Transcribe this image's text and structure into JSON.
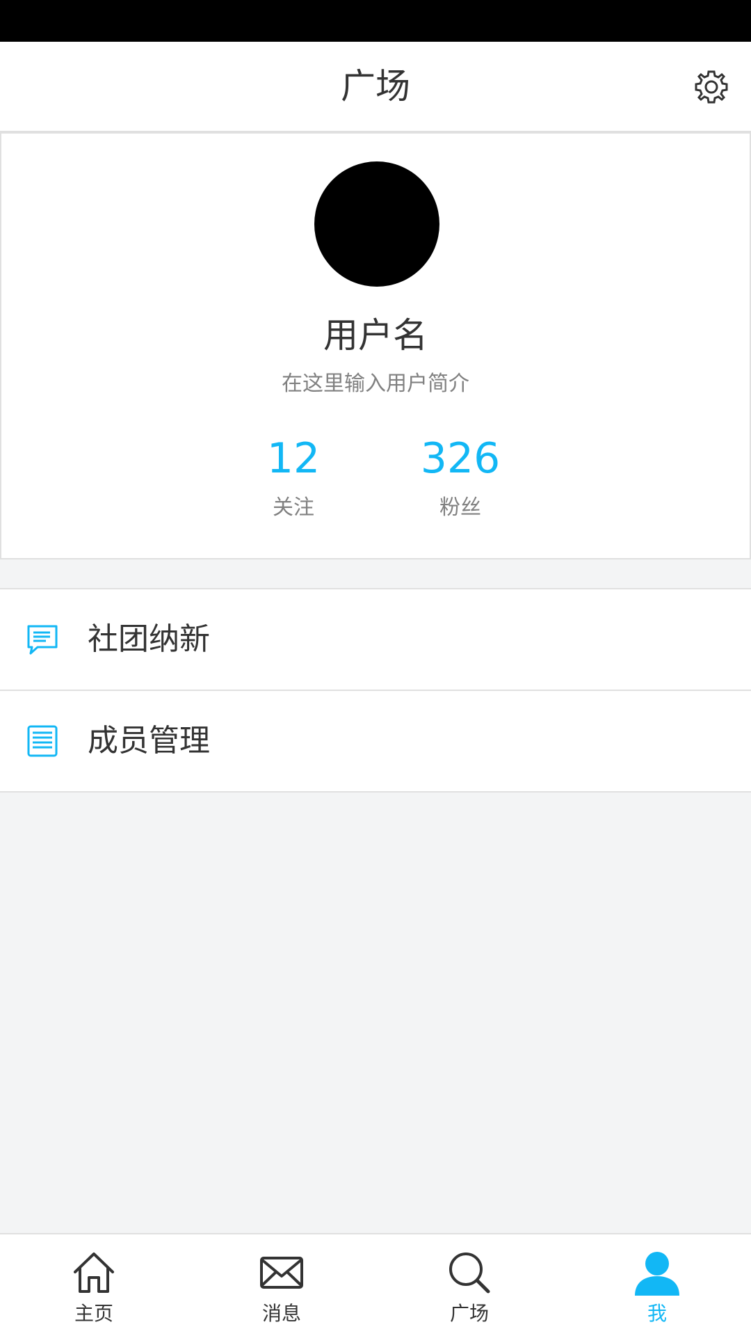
{
  "header": {
    "title": "广场",
    "settings_icon": "gear-icon"
  },
  "profile": {
    "username": "用户名",
    "bio": "在这里输入用户简介",
    "stats": [
      {
        "value": "12",
        "label": "关注"
      },
      {
        "value": "326",
        "label": "粉丝"
      }
    ]
  },
  "menu": {
    "items": [
      {
        "label": "社团纳新",
        "icon": "chat-bubble-icon"
      },
      {
        "label": "成员管理",
        "icon": "list-icon"
      }
    ]
  },
  "tabbar": {
    "items": [
      {
        "label": "主页",
        "icon": "home-icon",
        "active": false
      },
      {
        "label": "消息",
        "icon": "envelope-icon",
        "active": false
      },
      {
        "label": "广场",
        "icon": "search-icon",
        "active": false
      },
      {
        "label": "我",
        "icon": "user-icon",
        "active": true
      }
    ]
  },
  "colors": {
    "background": "#f3f4f5",
    "accent": "#12b7f5",
    "text_primary": "#333333",
    "text_secondary": "#808080",
    "divider": "#e0e0e0"
  }
}
